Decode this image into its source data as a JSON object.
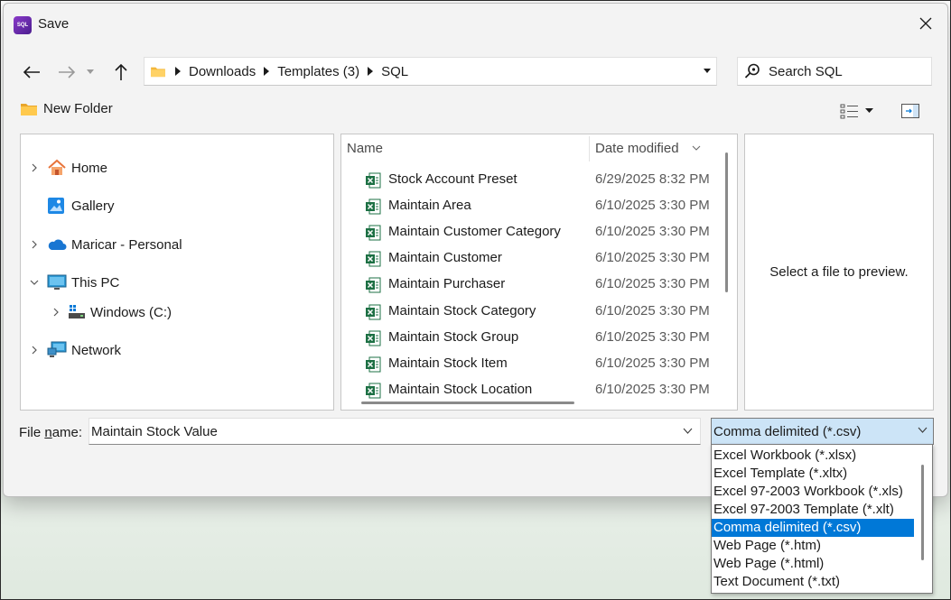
{
  "dialog": {
    "title": "Save",
    "app_icon_text": "SQL"
  },
  "address": {
    "crumbs": [
      "Downloads",
      "Templates (3)",
      "SQL"
    ]
  },
  "search": {
    "placeholder": "Search SQL"
  },
  "toolbar": {
    "new_folder_label": "New Folder"
  },
  "nav_pane": {
    "items": [
      {
        "label": "Home",
        "icon": "home-icon",
        "expandable": true,
        "expanded": false
      },
      {
        "label": "Gallery",
        "icon": "gallery-icon",
        "expandable": false
      },
      {
        "label": "Maricar - Personal",
        "icon": "onedrive-cloud-icon",
        "expandable": true,
        "expanded": false
      },
      {
        "label": "This PC",
        "icon": "monitor-icon",
        "expandable": true,
        "expanded": true
      },
      {
        "label": "Windows (C:)",
        "icon": "drive-icon",
        "expandable": true,
        "expanded": false
      },
      {
        "label": "Network",
        "icon": "network-icon",
        "expandable": true,
        "expanded": false
      }
    ]
  },
  "file_pane": {
    "columns": {
      "name": "Name",
      "date_modified": "Date modified"
    },
    "files": [
      {
        "name": "Stock Account Preset",
        "date": "6/29/2025 8:32 PM"
      },
      {
        "name": "Maintain Area",
        "date": "6/10/2025 3:30 PM"
      },
      {
        "name": "Maintain Customer Category",
        "date": "6/10/2025 3:30 PM"
      },
      {
        "name": "Maintain Customer",
        "date": "6/10/2025 3:30 PM"
      },
      {
        "name": "Maintain Purchaser",
        "date": "6/10/2025 3:30 PM"
      },
      {
        "name": "Maintain Stock Category",
        "date": "6/10/2025 3:30 PM"
      },
      {
        "name": "Maintain Stock Group",
        "date": "6/10/2025 3:30 PM"
      },
      {
        "name": "Maintain Stock Item",
        "date": "6/10/2025 3:30 PM"
      },
      {
        "name": "Maintain Stock Location",
        "date": "6/10/2025 3:30 PM"
      }
    ],
    "file_icon": "excel-file-icon"
  },
  "preview": {
    "message": "Select a file to preview."
  },
  "filename": {
    "label_pre": "File ",
    "label_mnemonic": "n",
    "label_post": "ame:",
    "value": "Maintain Stock Value"
  },
  "filetype": {
    "selected": "Comma delimited (*.csv)",
    "options": [
      "Excel Workbook (*.xlsx)",
      "Excel Template (*.xltx)",
      "Excel 97-2003 Workbook (*.xls)",
      "Excel 97-2003 Template (*.xlt)",
      "Comma delimited (*.csv)",
      "Web Page (*.htm)",
      "Web Page (*.html)",
      "Text Document (*.txt)"
    ],
    "selected_index": 4
  },
  "colors": {
    "accent": "#0078d7",
    "select_bg": "#cce4f7",
    "folder": "#f4b73b",
    "excel": "#1d7044"
  }
}
